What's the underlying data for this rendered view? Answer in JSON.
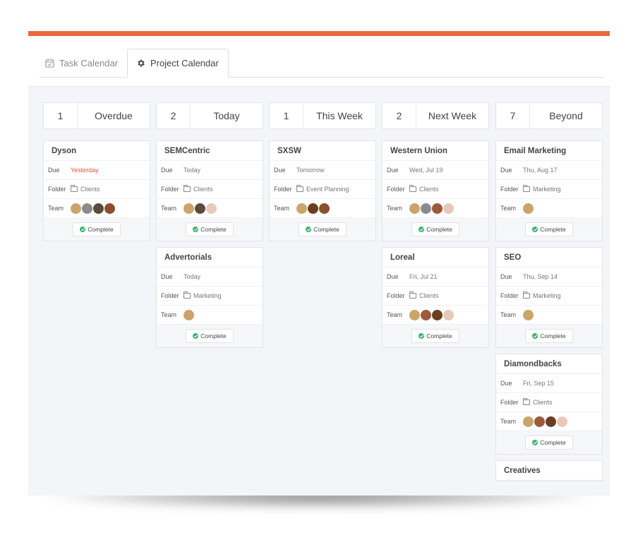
{
  "tabs": [
    {
      "label": "Task Calendar",
      "icon": "calendar-icon",
      "active": false
    },
    {
      "label": "Project Calendar",
      "icon": "gear-icon",
      "active": true
    }
  ],
  "accent_color": "#ea6a3b",
  "complete_color": "#3db36b",
  "overdue_color": "#e0543b",
  "columns": [
    {
      "count": "1",
      "label": "Overdue",
      "cards": [
        {
          "title": "Dyson",
          "due_label": "Due",
          "due": "Yesterday",
          "due_overdue": true,
          "folder_label": "Folder",
          "folder": "Clients",
          "team_label": "Team",
          "team": [
            "#c9a56b",
            "#8b8b8b",
            "#5a4a40",
            "#8a4f2e"
          ],
          "action": "Complete"
        }
      ]
    },
    {
      "count": "2",
      "label": "Today",
      "cards": [
        {
          "title": "SEMCentric",
          "due_label": "Due",
          "due": "Today",
          "due_overdue": false,
          "folder_label": "Folder",
          "folder": "Clients",
          "team_label": "Team",
          "team": [
            "#c9a56b",
            "#5a4a40",
            "#e8c8b8"
          ],
          "action": "Complete"
        },
        {
          "title": "Advertorials",
          "due_label": "Due",
          "due": "Today",
          "due_overdue": false,
          "folder_label": "Folder",
          "folder": "Marketing",
          "team_label": "Team",
          "team": [
            "#c9a56b"
          ],
          "action": "Complete"
        }
      ]
    },
    {
      "count": "1",
      "label": "This Week",
      "cards": [
        {
          "title": "SXSW",
          "due_label": "Due",
          "due": "Tomorrow",
          "due_overdue": false,
          "folder_label": "Folder",
          "folder": "Event Planning",
          "team_label": "Team",
          "team": [
            "#c9a56b",
            "#6b3e22",
            "#8a4f2e"
          ],
          "action": "Complete"
        }
      ]
    },
    {
      "count": "2",
      "label": "Next Week",
      "cards": [
        {
          "title": "Western Union",
          "due_label": "Due",
          "due": "Wed, Jul 19",
          "due_overdue": false,
          "folder_label": "Folder",
          "folder": "Clients",
          "team_label": "Team",
          "team": [
            "#c9a56b",
            "#8b8b8b",
            "#9a5a3c",
            "#e8c8b8"
          ],
          "action": "Complete"
        },
        {
          "title": "Loreal",
          "due_label": "Due",
          "due": "Fri, Jul 21",
          "due_overdue": false,
          "folder_label": "Folder",
          "folder": "Clients",
          "team_label": "Team",
          "team": [
            "#c9a56b",
            "#9a5a3c",
            "#6b3e22",
            "#e8c8b8"
          ],
          "action": "Complete"
        }
      ]
    },
    {
      "count": "7",
      "label": "Beyond",
      "cards": [
        {
          "title": "Email Marketing",
          "due_label": "Due",
          "due": "Thu, Aug 17",
          "due_overdue": false,
          "folder_label": "Folder",
          "folder": "Marketing",
          "team_label": "Team",
          "team": [
            "#c9a56b"
          ],
          "action": "Complete"
        },
        {
          "title": "SEO",
          "due_label": "Due",
          "due": "Thu, Sep 14",
          "due_overdue": false,
          "folder_label": "Folder",
          "folder": "Marketing",
          "team_label": "Team",
          "team": [
            "#c9a56b"
          ],
          "action": "Complete"
        },
        {
          "title": "Diamondbacks",
          "due_label": "Due",
          "due": "Fri, Sep 15",
          "due_overdue": false,
          "folder_label": "Folder",
          "folder": "Clients",
          "team_label": "Team",
          "team": [
            "#c9a56b",
            "#9a5a3c",
            "#6b3e22",
            "#e8c8b8"
          ],
          "action": "Complete"
        },
        {
          "title": "Creatives",
          "partial": true
        }
      ]
    }
  ]
}
